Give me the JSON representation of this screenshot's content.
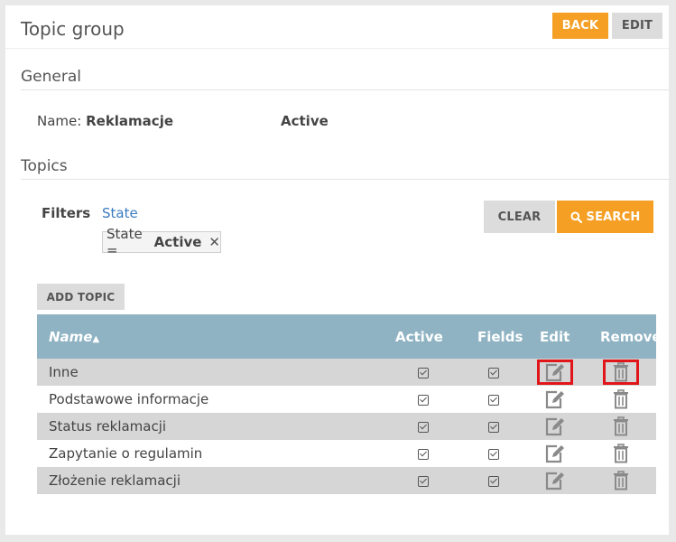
{
  "page": {
    "title": "Topic group"
  },
  "header": {
    "back_label": "BACK",
    "edit_label": "EDIT"
  },
  "general": {
    "section_title": "General",
    "name_label": "Name:",
    "name_value": "Reklamacje",
    "status": "Active"
  },
  "topics": {
    "section_title": "Topics",
    "filters_label": "Filters",
    "state_link": "State",
    "chip": {
      "label": "State =",
      "value": "Active",
      "remove_icon": "close-icon"
    },
    "clear_label": "CLEAR",
    "search_label": "SEARCH",
    "search_icon": "search-icon",
    "add_topic_label": "ADD TOPIC"
  },
  "table": {
    "headers": {
      "name": "Name",
      "sort_indicator": "▲",
      "active": "Active",
      "fields": "Fields",
      "edit": "Edit",
      "remove": "Remove"
    },
    "rows": [
      {
        "name": "Inne",
        "active": true,
        "fields": true
      },
      {
        "name": "Podstawowe informacje",
        "active": true,
        "fields": true
      },
      {
        "name": "Status reklamacji",
        "active": true,
        "fields": true
      },
      {
        "name": "Zapytanie o regulamin",
        "active": true,
        "fields": true
      },
      {
        "name": "Złożenie reklamacji",
        "active": true,
        "fields": true
      }
    ]
  },
  "colors": {
    "accent_orange": "#f5a025",
    "table_header": "#8fb3c3",
    "link_blue": "#3a7abf",
    "highlight_red": "#e0161a"
  }
}
